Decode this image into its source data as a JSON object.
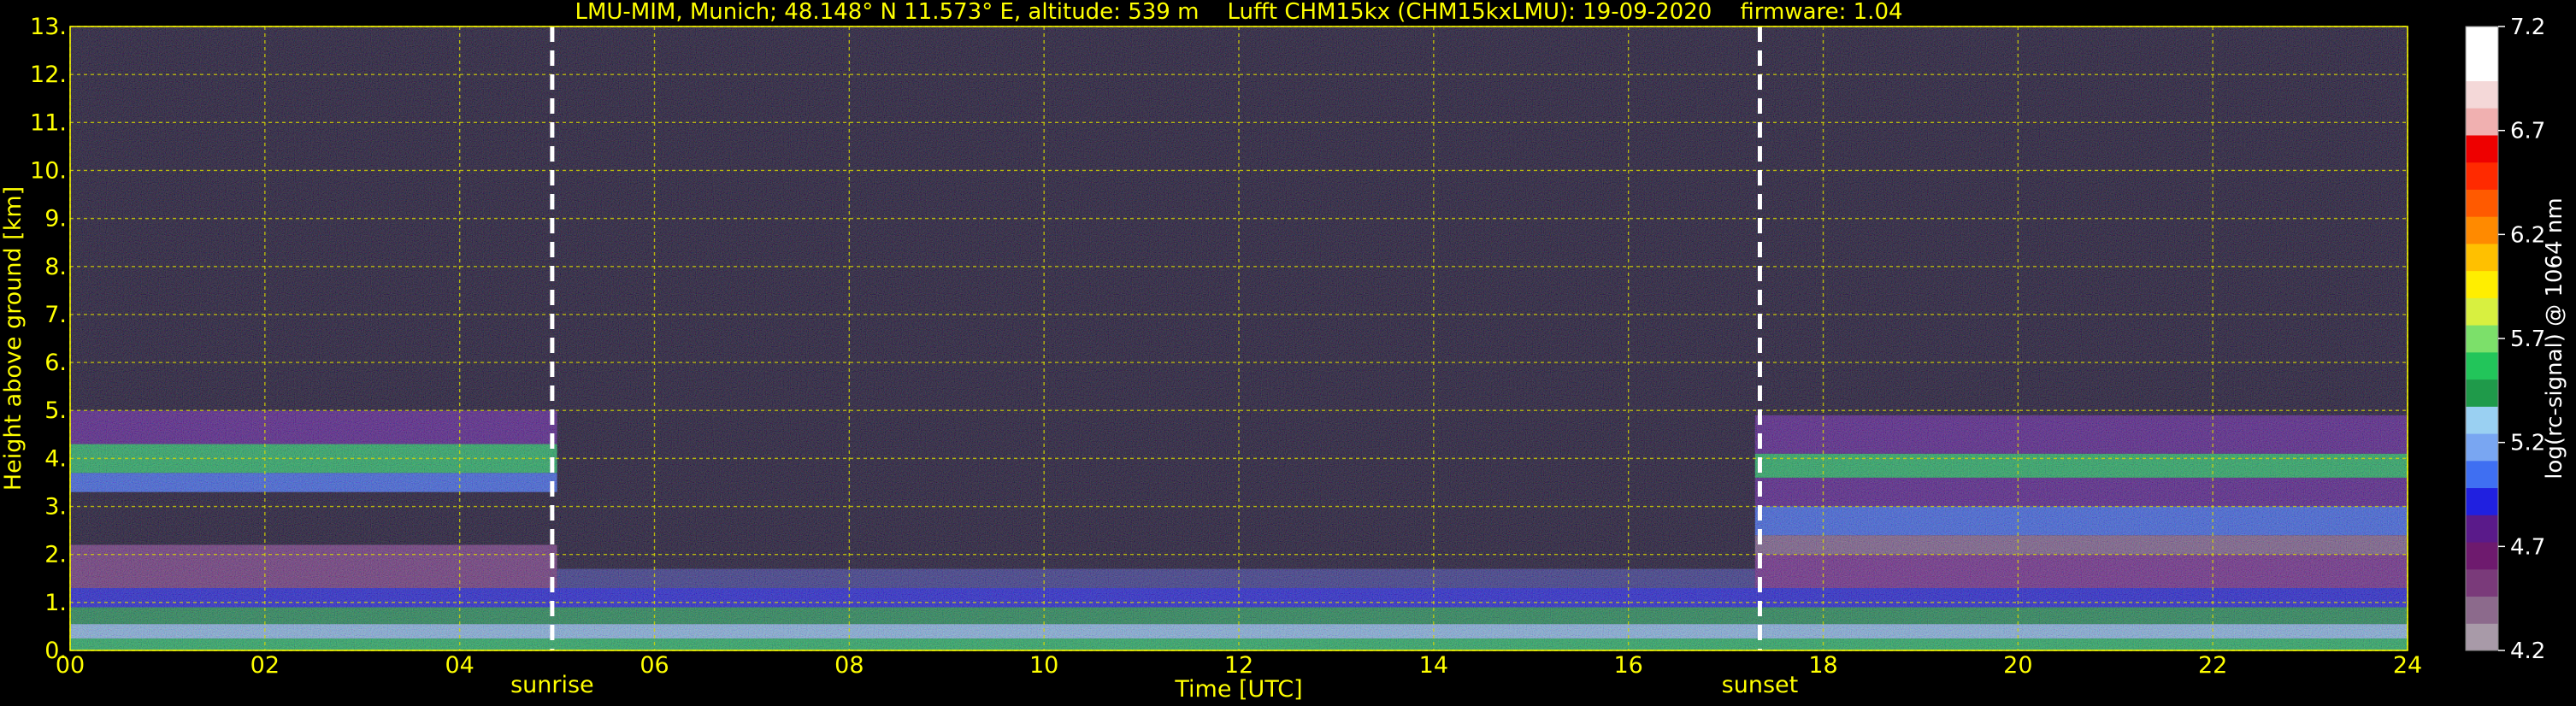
{
  "chart_data": {
    "type": "heatmap",
    "title": "LMU-MIM, Munich; 48.148° N 11.573° E, altitude: 539 m    Lufft CHM15kx (CHM15kxLMU): 19-09-2020    firmware: 1.04",
    "xlabel": "Time [UTC]",
    "ylabel": "Height above ground [km]",
    "xlim": [
      0,
      24
    ],
    "ylim": [
      0,
      13
    ],
    "x_ticks": [
      "00",
      "02",
      "04",
      "06",
      "08",
      "10",
      "12",
      "14",
      "16",
      "18",
      "20",
      "22",
      "24"
    ],
    "y_ticks": [
      "0.",
      "1.",
      "2.",
      "3.",
      "4.",
      "5.",
      "6.",
      "7.",
      "8.",
      "9.",
      "10.",
      "11.",
      "12.",
      "13."
    ],
    "grid": true,
    "annotations": [
      {
        "label": "sunrise",
        "time": 4.95
      },
      {
        "label": "sunset",
        "time": 17.35
      }
    ],
    "colorbar": {
      "label": "log(rc-signal) @ 1064 nm",
      "ticks": [
        "4.2",
        "4.7",
        "5.2",
        "5.7",
        "6.2",
        "6.7",
        "7.2"
      ],
      "range": [
        4.2,
        7.2
      ],
      "colors": [
        "#a89aa8",
        "#8c6a8c",
        "#7a3a7a",
        "#6e1a6e",
        "#5a1a8a",
        "#2020e0",
        "#3f6ff2",
        "#79a6f2",
        "#9ad0f2",
        "#1f9a4a",
        "#22c55a",
        "#7ce06a",
        "#d8f040",
        "#ffee00",
        "#ffc000",
        "#ff8a00",
        "#ff5a00",
        "#ff2a00",
        "#ee0000",
        "#f0b0b0",
        "#f4d8d8",
        "#ffffff",
        "#ffffff"
      ]
    },
    "layers": [
      {
        "t0": 0,
        "t1": 24,
        "h0": 0.0,
        "h1": 0.25,
        "color": "#22c55a"
      },
      {
        "t0": 0,
        "t1": 24,
        "h0": 0.25,
        "h1": 0.55,
        "color": "#9ad0f2"
      },
      {
        "t0": 0,
        "t1": 24,
        "h0": 0.55,
        "h1": 0.9,
        "color": "#1f9a4a"
      },
      {
        "t0": 0,
        "t1": 24,
        "h0": 0.9,
        "h1": 1.3,
        "color": "#2020e0"
      },
      {
        "t0": 0,
        "t1": 5,
        "h0": 1.3,
        "h1": 2.2,
        "color": "#7a3a7a"
      },
      {
        "t0": 0,
        "t1": 5,
        "h0": 3.3,
        "h1": 3.7,
        "color": "#3f6ff2"
      },
      {
        "t0": 0,
        "t1": 5,
        "h0": 3.7,
        "h1": 4.3,
        "color": "#22c55a"
      },
      {
        "t0": 0,
        "t1": 5,
        "h0": 4.3,
        "h1": 5.0,
        "color": "#5a1a8a"
      },
      {
        "t0": 5,
        "t1": 17.3,
        "h0": 1.3,
        "h1": 1.7,
        "color": "#3a3a8a"
      },
      {
        "t0": 17.3,
        "t1": 24,
        "h0": 1.3,
        "h1": 2.0,
        "color": "#7a2a8a"
      },
      {
        "t0": 17.3,
        "t1": 24,
        "h0": 2.0,
        "h1": 2.4,
        "color": "#8c6a8c"
      },
      {
        "t0": 17.3,
        "t1": 24,
        "h0": 2.4,
        "h1": 3.0,
        "color": "#3f6ff2"
      },
      {
        "t0": 17.3,
        "t1": 24,
        "h0": 3.0,
        "h1": 3.6,
        "color": "#5a1a8a"
      },
      {
        "t0": 17.3,
        "t1": 24,
        "h0": 3.6,
        "h1": 4.1,
        "color": "#22c55a"
      },
      {
        "t0": 17.3,
        "t1": 24,
        "h0": 4.1,
        "h1": 4.9,
        "color": "#5a1a8a"
      }
    ]
  }
}
